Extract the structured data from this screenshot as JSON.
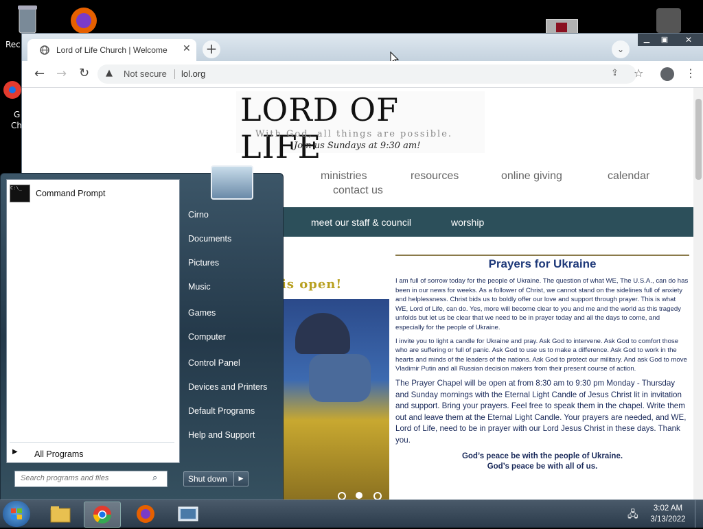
{
  "desktop": {
    "recycle_label": "Rec",
    "chrome_label_1": "G",
    "chrome_label_2": "Ch"
  },
  "browser": {
    "tab_title": "Lord of Life Church | Welcome",
    "security_label": "Not secure",
    "url": "lol.org"
  },
  "site": {
    "logo_title": "LORD OF LIFE",
    "logo_tagline": "With God, all things are possible.",
    "logo_sunday": "Join us Sundays at 9:30 am!",
    "nav": [
      "ministries",
      "resources",
      "online giving",
      "calendar",
      "contact us"
    ],
    "subnav": [
      "meet our staff & council",
      "worship"
    ],
    "banner_text": "is open!",
    "prayer_title": "Prayers for Ukraine",
    "prayer_p1": "I am full of sorrow today for the people of Ukraine. The question of what WE, The U.S.A., can do has been in our news for weeks. As a follower of Christ, we cannot stand on the sidelines full of anxiety and helplessness. Christ bids us to boldly offer our love and support through prayer. This is what WE, Lord of Life, can do. Yes, more will become clear to you and me and the world as this tragedy unfolds but let us be clear that we need to be in prayer today and all the days to come, and especially for the people of Ukraine.",
    "prayer_p2": "I invite you to light a candle for Ukraine and pray. Ask God to intervene. Ask God to comfort those who are suffering or full of panic. Ask God to use us to make a difference. Ask God to work in the hearts and minds of the leaders of the nations. Ask God to protect our military. And ask God to move Vladimir Putin and all Russian decision makers from their present course of action.",
    "prayer_p3": "The Prayer Chapel will be open at from 8:30 am to 9:30 pm Monday - Thursday and Sunday mornings with the Eternal Light Candle of Jesus Christ lit in invitation and support. Bring your prayers. Feel free to speak them in the chapel. Write them out and leave them at the Eternal Light Candle. Your prayers are needed, and WE, Lord of Life, need to be in prayer with our Lord Jesus Christ in these days. Thank you.",
    "prayer_close1": "God’s peace be with the people of Ukraine.",
    "prayer_close2": "God’s peace be with all of us."
  },
  "start_menu": {
    "pinned": [
      "Command Prompt"
    ],
    "all_programs": "All Programs",
    "search_placeholder": "Search programs and files",
    "right_items": [
      "Cirno",
      "Documents",
      "Pictures",
      "Music",
      "Games",
      "Computer",
      "Control Panel",
      "Devices and Printers",
      "Default Programs",
      "Help and Support"
    ],
    "shutdown": "Shut down"
  },
  "taskbar": {
    "time": "3:02 AM",
    "date": "3/13/2022"
  },
  "colors": {
    "subnav_bg": "#2c4f5a",
    "prayer_title": "#1f3a7a",
    "banner_gold": "#b8a020"
  }
}
